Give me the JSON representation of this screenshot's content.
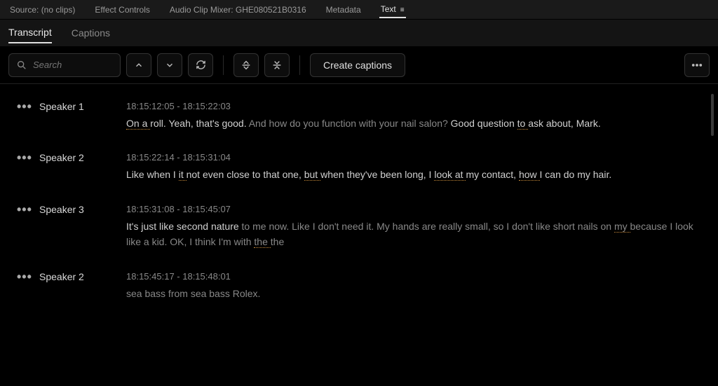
{
  "top_tabs": [
    {
      "label": "Source: (no clips)",
      "active": false
    },
    {
      "label": "Effect Controls",
      "active": false
    },
    {
      "label": "Audio Clip Mixer: GHE080521B0316",
      "active": false
    },
    {
      "label": "Metadata",
      "active": false
    },
    {
      "label": "Text",
      "active": true,
      "has_menu": true
    }
  ],
  "sub_tabs": [
    {
      "label": "Transcript",
      "active": true
    },
    {
      "label": "Captions",
      "active": false
    }
  ],
  "search": {
    "placeholder": "Search",
    "value": ""
  },
  "toolbar": {
    "create_captions_label": "Create captions"
  },
  "transcript": [
    {
      "speaker": "Speaker 1",
      "time": "18:15:12:05 - 18:15:22:03",
      "segments": [
        {
          "t": "On a ",
          "marked": true
        },
        {
          "t": "roll. Yeah, that's good. "
        },
        {
          "t": "And how do you function with your nail salon? ",
          "faded": true
        },
        {
          "t": "Good question "
        },
        {
          "t": "to ",
          "marked": true
        },
        {
          "t": "ask about, Mark."
        }
      ]
    },
    {
      "speaker": "Speaker 2",
      "time": "18:15:22:14 - 18:15:31:04",
      "segments": [
        {
          "t": "Like when I "
        },
        {
          "t": "it ",
          "marked": true
        },
        {
          "t": "not even close to that one, "
        },
        {
          "t": "but ",
          "marked": true
        },
        {
          "t": "when they've been long, I "
        },
        {
          "t": "look at ",
          "marked": true
        },
        {
          "t": "my contact, "
        },
        {
          "t": "how ",
          "marked": true
        },
        {
          "t": "I can do my hair."
        }
      ]
    },
    {
      "speaker": "Speaker 3",
      "time": "18:15:31:08 - 18:15:45:07",
      "segments": [
        {
          "t": "It's just like second nature "
        },
        {
          "t": "to me now. Like I don't need it. My hands are really small, so I don't like short nails on ",
          "faded": true
        },
        {
          "t": "my ",
          "marked": true,
          "faded": true
        },
        {
          "t": "because I look like a kid. OK, I think I'm with ",
          "faded": true
        },
        {
          "t": "the ",
          "marked": true,
          "faded": true
        },
        {
          "t": "the",
          "faded": true
        }
      ]
    },
    {
      "speaker": "Speaker 2",
      "time": "18:15:45:17 - 18:15:48:01",
      "segments": [
        {
          "t": "sea bass from sea bass Rolex.",
          "faded": true
        }
      ]
    }
  ]
}
